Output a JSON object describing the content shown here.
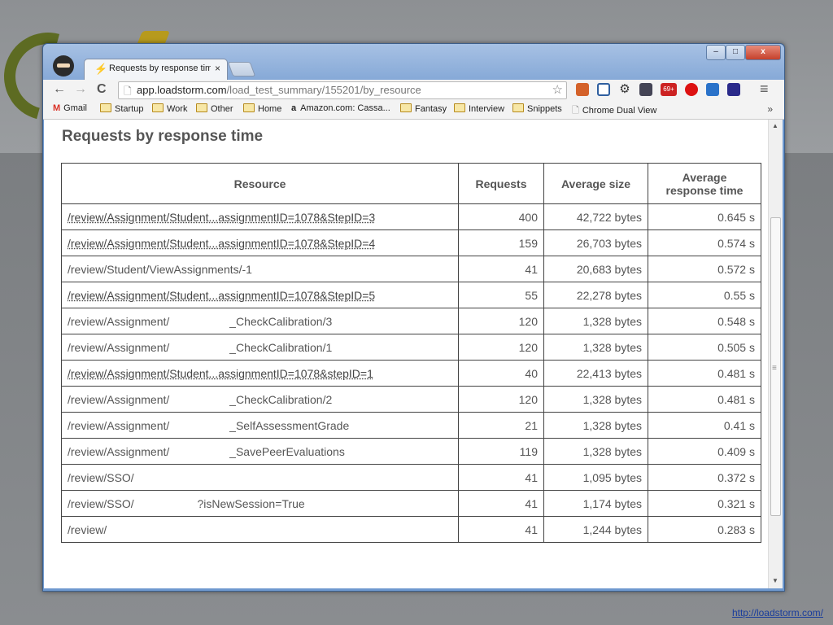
{
  "slide": {
    "footer_link": "http://loadstorm.com/"
  },
  "browser": {
    "tab_title": "Requests by response time",
    "tab_close": "×",
    "win_min": "–",
    "win_max": "□",
    "win_close": "x",
    "url_host": "app.loadstorm.com",
    "url_path": "/load_test_summary/155201/by_resource",
    "back": "←",
    "forward": "→",
    "reload": "C",
    "menu": "≡",
    "star": "☆",
    "bookmarks": [
      {
        "label": "Gmail",
        "icon": "gmail-icon"
      },
      {
        "label": "Startup",
        "icon": "folder-icon"
      },
      {
        "label": "Work",
        "icon": "folder-icon"
      },
      {
        "label": "Other",
        "icon": "folder-icon"
      },
      {
        "label": "Home",
        "icon": "folder-icon"
      },
      {
        "label": "Amazon.com: Cassa...",
        "icon": "amazon-icon"
      },
      {
        "label": "Fantasy",
        "icon": "folder-icon"
      },
      {
        "label": "Interview",
        "icon": "folder-icon"
      },
      {
        "label": "Snippets",
        "icon": "folder-icon"
      },
      {
        "label": "Chrome Dual View",
        "icon": "page-icon"
      }
    ],
    "bookmarks_more": "»",
    "extension_badge": "69+"
  },
  "page": {
    "title": "Requests by response time",
    "columns": {
      "resource": "Resource",
      "requests": "Requests",
      "avg_size": "Average size",
      "avg_time_line1": "Average",
      "avg_time_line2": "response time"
    },
    "rows": [
      {
        "resource": "/review/Assignment/Student...assignmentID=1078&StepID=3",
        "link": true,
        "requests": "400",
        "size": "42,722 bytes",
        "time": "0.645 s"
      },
      {
        "resource": "/review/Assignment/Student...assignmentID=1078&StepID=4",
        "link": true,
        "requests": "159",
        "size": "26,703 bytes",
        "time": "0.574 s"
      },
      {
        "resource": "/review/Student/ViewAssignments/-1",
        "link": false,
        "requests": "41",
        "size": "20,683 bytes",
        "time": "0.572 s"
      },
      {
        "resource": "/review/Assignment/Student...assignmentID=1078&StepID=5",
        "link": true,
        "requests": "55",
        "size": "22,278 bytes",
        "time": "0.55 s"
      },
      {
        "resource": "/review/Assignment/                   _CheckCalibration/3",
        "link": false,
        "requests": "120",
        "size": "1,328 bytes",
        "time": "0.548 s"
      },
      {
        "resource": "/review/Assignment/                   _CheckCalibration/1",
        "link": false,
        "requests": "120",
        "size": "1,328 bytes",
        "time": "0.505 s"
      },
      {
        "resource": "/review/Assignment/Student...assignmentID=1078&stepID=1",
        "link": true,
        "requests": "40",
        "size": "22,413 bytes",
        "time": "0.481 s"
      },
      {
        "resource": "/review/Assignment/                   _CheckCalibration/2",
        "link": false,
        "requests": "120",
        "size": "1,328 bytes",
        "time": "0.481 s"
      },
      {
        "resource": "/review/Assignment/                   _SelfAssessmentGrade",
        "link": false,
        "requests": "21",
        "size": "1,328 bytes",
        "time": "0.41 s"
      },
      {
        "resource": "/review/Assignment/                   _SavePeerEvaluations",
        "link": false,
        "requests": "119",
        "size": "1,328 bytes",
        "time": "0.409 s"
      },
      {
        "resource": "/review/SSO/",
        "link": false,
        "requests": "41",
        "size": "1,095 bytes",
        "time": "0.372 s"
      },
      {
        "resource": "/review/SSO/                    ?isNewSession=True",
        "link": false,
        "requests": "41",
        "size": "1,174 bytes",
        "time": "0.321 s"
      },
      {
        "resource": "/review/",
        "link": false,
        "requests": "41",
        "size": "1,244 bytes",
        "time": "0.283 s"
      }
    ]
  },
  "colors": {
    "accent_window": "#6f99cf",
    "text": "#555555",
    "footer_link": "#1a3d9c"
  }
}
